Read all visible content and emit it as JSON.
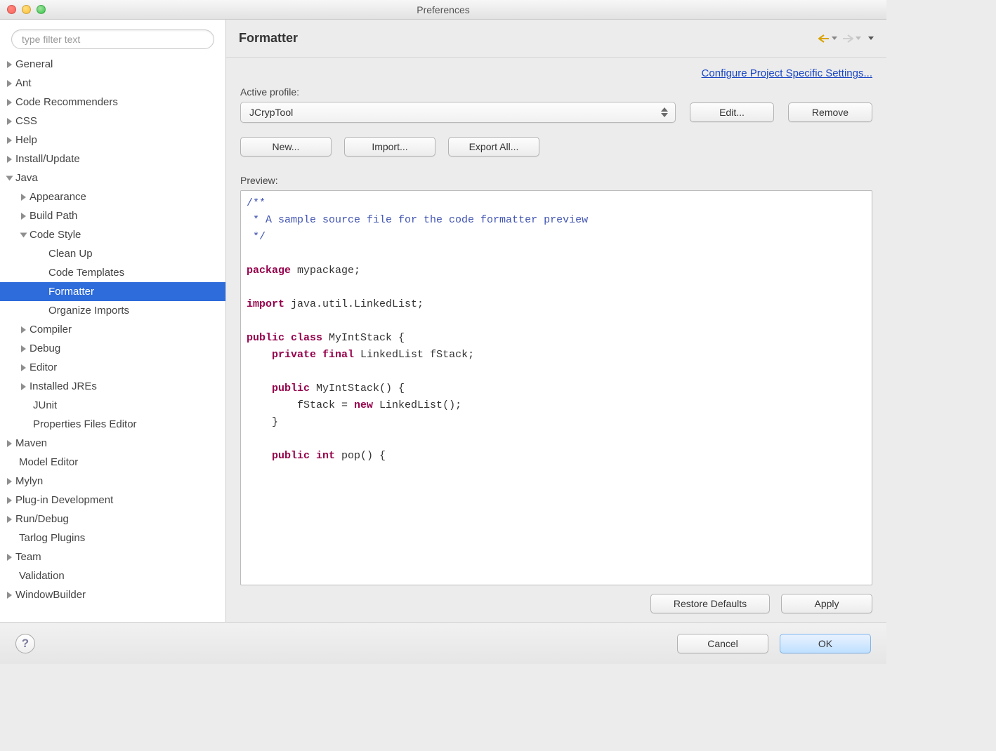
{
  "window": {
    "title": "Preferences"
  },
  "sidebar": {
    "filter_placeholder": "type filter text",
    "items": [
      {
        "label": "General",
        "indent": 0,
        "disclosure": "closed"
      },
      {
        "label": "Ant",
        "indent": 0,
        "disclosure": "closed"
      },
      {
        "label": "Code Recommenders",
        "indent": 0,
        "disclosure": "closed"
      },
      {
        "label": "CSS",
        "indent": 0,
        "disclosure": "closed"
      },
      {
        "label": "Help",
        "indent": 0,
        "disclosure": "closed"
      },
      {
        "label": "Install/Update",
        "indent": 0,
        "disclosure": "closed"
      },
      {
        "label": "Java",
        "indent": 0,
        "disclosure": "open"
      },
      {
        "label": "Appearance",
        "indent": 1,
        "disclosure": "closed"
      },
      {
        "label": "Build Path",
        "indent": 1,
        "disclosure": "closed"
      },
      {
        "label": "Code Style",
        "indent": 1,
        "disclosure": "open"
      },
      {
        "label": "Clean Up",
        "indent": 2,
        "disclosure": "none"
      },
      {
        "label": "Code Templates",
        "indent": 2,
        "disclosure": "none"
      },
      {
        "label": "Formatter",
        "indent": 2,
        "disclosure": "none",
        "selected": true
      },
      {
        "label": "Organize Imports",
        "indent": 2,
        "disclosure": "none"
      },
      {
        "label": "Compiler",
        "indent": 1,
        "disclosure": "closed"
      },
      {
        "label": "Debug",
        "indent": 1,
        "disclosure": "closed"
      },
      {
        "label": "Editor",
        "indent": 1,
        "disclosure": "closed"
      },
      {
        "label": "Installed JREs",
        "indent": 1,
        "disclosure": "closed"
      },
      {
        "label": "JUnit",
        "indent": 1,
        "disclosure": "none"
      },
      {
        "label": "Properties Files Editor",
        "indent": 1,
        "disclosure": "none"
      },
      {
        "label": "Maven",
        "indent": 0,
        "disclosure": "closed"
      },
      {
        "label": "Model Editor",
        "indent": 0,
        "disclosure": "none"
      },
      {
        "label": "Mylyn",
        "indent": 0,
        "disclosure": "closed"
      },
      {
        "label": "Plug-in Development",
        "indent": 0,
        "disclosure": "closed"
      },
      {
        "label": "Run/Debug",
        "indent": 0,
        "disclosure": "closed"
      },
      {
        "label": "Tarlog Plugins",
        "indent": 0,
        "disclosure": "none"
      },
      {
        "label": "Team",
        "indent": 0,
        "disclosure": "closed"
      },
      {
        "label": "Validation",
        "indent": 0,
        "disclosure": "none"
      },
      {
        "label": "WindowBuilder",
        "indent": 0,
        "disclosure": "closed"
      }
    ]
  },
  "main": {
    "title": "Formatter",
    "project_link": "Configure Project Specific Settings...",
    "active_profile_label": "Active profile:",
    "active_profile_value": "JCrypTool",
    "edit_btn": "Edit...",
    "remove_btn": "Remove",
    "new_btn": "New...",
    "import_btn": "Import...",
    "export_btn": "Export All...",
    "preview_label": "Preview:",
    "restore_btn": "Restore Defaults",
    "apply_btn": "Apply",
    "preview_code": {
      "l1": "/**",
      "l2": " * A sample source file for the code formatter preview",
      "l3": " */",
      "l4_kw": "package",
      "l4_rest": " mypackage;",
      "l5_kw": "import",
      "l5_rest": " java.util.LinkedList;",
      "l6_kw": "public class",
      "l6_rest": " MyIntStack {",
      "l7_kw": "private final",
      "l7_rest": " LinkedList fStack;",
      "l8_kw": "public",
      "l8_rest": " MyIntStack() {",
      "l9_pre": "        fStack = ",
      "l9_kw": "new",
      "l9_rest": " LinkedList();",
      "l10": "    }",
      "l11_kw": "public int",
      "l11_rest": " pop() {"
    }
  },
  "bottom": {
    "cancel": "Cancel",
    "ok": "OK"
  }
}
